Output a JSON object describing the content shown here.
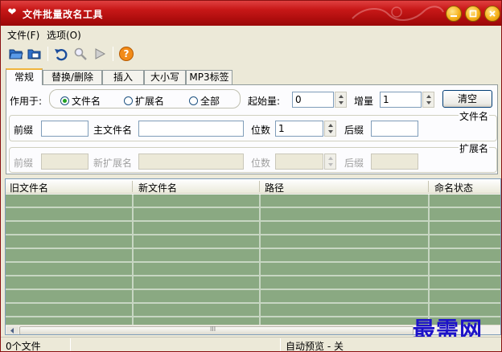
{
  "window": {
    "title": "文件批量改名工具"
  },
  "menu": {
    "file": "文件(F)",
    "options": "选项(O)"
  },
  "toolbar": {
    "icons": [
      "open-folder-icon",
      "save-folder-icon",
      "undo-icon",
      "preview-icon",
      "run-icon",
      "help-icon"
    ],
    "help_glyph": "?"
  },
  "tabs": [
    "常规",
    "替换/删除",
    "插入",
    "大小写",
    "MP3标签"
  ],
  "settings": {
    "apply_to_label": "作用于:",
    "apply_options": [
      "文件名",
      "扩展名",
      "全部"
    ],
    "apply_selected": "文件名",
    "start_label": "起始量:",
    "start_value": "0",
    "increment_label": "增量",
    "increment_value": "1",
    "clear_button": "清空"
  },
  "filename_section": {
    "title": "文件名",
    "prefix_label": "前缀",
    "main_label": "主文件名",
    "digits_label": "位数",
    "digits_value": "1",
    "suffix_label": "后缀"
  },
  "extension_section": {
    "title": "扩展名",
    "prefix_label": "前缀",
    "new_ext_label": "新扩展名",
    "digits_label": "位数",
    "suffix_label": "后缀"
  },
  "grid": {
    "columns": [
      "旧文件名",
      "新文件名",
      "路径",
      "命名状态"
    ],
    "row_count_visible": 10,
    "row_color": "#8aa982",
    "scroll_grip_glyph": "III"
  },
  "watermark": "最需网",
  "status": {
    "file_count": "0个文件",
    "preview": "自动预览 - 关"
  },
  "colors": {
    "title_bar": "#b00e0e",
    "accent_tab": "#f0b43c",
    "watermark": "#1d12c9"
  }
}
